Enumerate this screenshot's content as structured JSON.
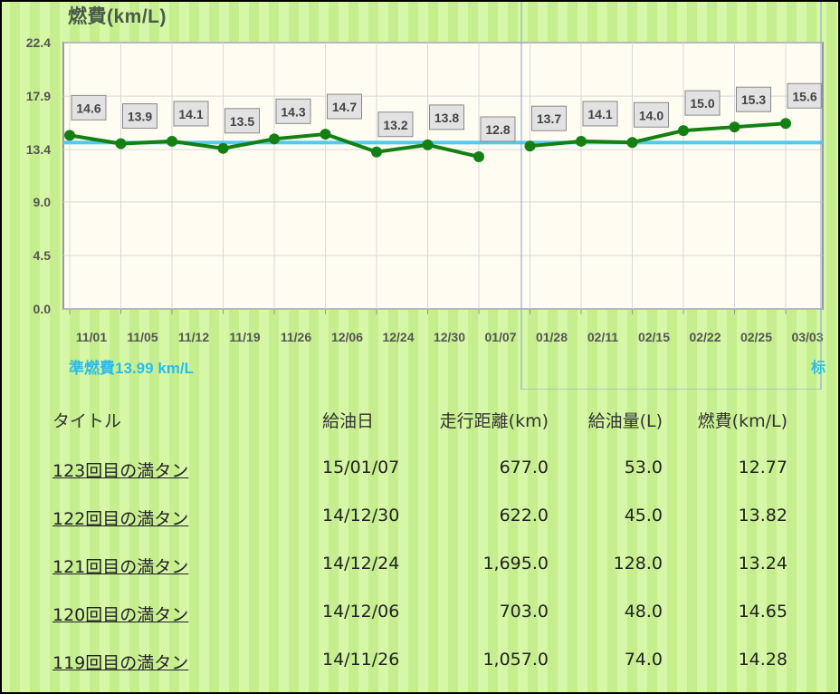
{
  "chart": {
    "title": "燃費(km/L)",
    "reference_label": "準燃費13.99 km/L",
    "reference_label_right": "标",
    "colors": {
      "line": "#148014",
      "reference": "#55c8ec",
      "plot_bg": "#fffdf2",
      "grid": "#d8d8d8"
    }
  },
  "chart_data": {
    "type": "line",
    "title": "燃費(km/L)",
    "categories": [
      "11/01",
      "11/05",
      "11/12",
      "11/19",
      "11/26",
      "12/06",
      "12/24",
      "12/30",
      "01/07",
      "01/28",
      "02/11",
      "02/15",
      "02/22",
      "02/25",
      "03/03"
    ],
    "series": [
      {
        "name": "",
        "values": [
          14.6,
          13.9,
          14.1,
          13.5,
          14.3,
          14.7,
          13.2,
          13.8,
          12.8,
          13.7,
          14.1,
          14.0,
          15.0,
          15.3,
          15.6
        ]
      }
    ],
    "gap_after_index": 8,
    "reference_value": 13.99,
    "yticks": [
      "0.0",
      "4.5",
      "9.0",
      "13.4",
      "17.9",
      "22.4"
    ],
    "ylim": [
      0,
      22.4
    ],
    "grid": true
  },
  "table": {
    "headers": {
      "title": "タイトル",
      "date": "給油日",
      "distance": "走行距離(km)",
      "fuel": "給油量(L)",
      "efficiency": "燃費(km/L)"
    },
    "rows": [
      {
        "title": "123回目の満タン",
        "date": "15/01/07",
        "distance": "677.0",
        "fuel": "53.0",
        "efficiency": "12.77"
      },
      {
        "title": "122回目の満タン",
        "date": "14/12/30",
        "distance": "622.0",
        "fuel": "45.0",
        "efficiency": "13.82"
      },
      {
        "title": "121回目の満タン",
        "date": "14/12/24",
        "distance": "1,695.0",
        "fuel": "128.0",
        "efficiency": "13.24"
      },
      {
        "title": "120回目の満タン",
        "date": "14/12/06",
        "distance": "703.0",
        "fuel": "48.0",
        "efficiency": "14.65"
      },
      {
        "title": "119回目の満タン",
        "date": "14/11/26",
        "distance": "1,057.0",
        "fuel": "74.0",
        "efficiency": "14.28"
      }
    ]
  }
}
